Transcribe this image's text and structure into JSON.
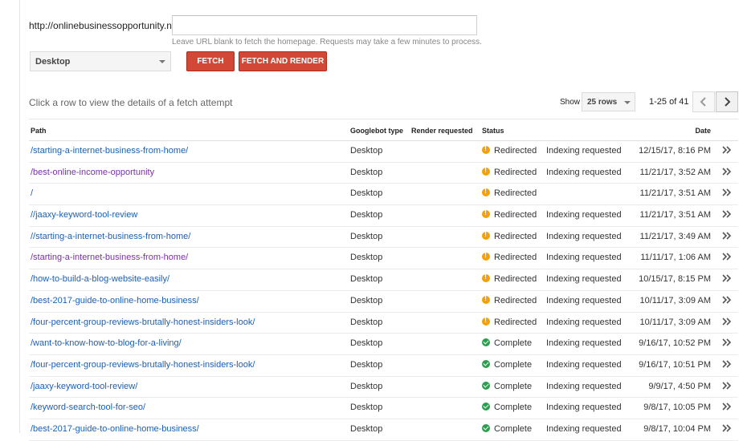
{
  "fetch_form": {
    "url_prefix": "http://onlinebusinessopportunity.net/",
    "url_value": "",
    "url_placeholder": "",
    "url_hint": "Leave URL blank to fetch the homepage. Requests may take a few minutes to process.",
    "device_selected": "Desktop",
    "fetch_label": "FETCH",
    "fetch_render_label": "FETCH AND RENDER",
    "accent_color": "#d14836"
  },
  "toolbar": {
    "hint": "Click a row to view the details of a fetch attempt",
    "show_label": "Show",
    "rows_selected": "25 rows",
    "page_range": "1-25 of 41"
  },
  "table": {
    "headers": {
      "path": "Path",
      "googlebot_type": "Googlebot type",
      "render_requested": "Render requested",
      "status": "Status",
      "date": "Date"
    },
    "rows": [
      {
        "path": "/starting-a-internet-business-from-home/",
        "visited": false,
        "type": "Desktop",
        "status": "Redirected",
        "status_icon": "warning-icon",
        "indexing": "Indexing requested",
        "date": "12/15/17, 8:16 PM"
      },
      {
        "path": "/best-online-income-opportunity",
        "visited": true,
        "type": "Desktop",
        "status": "Redirected",
        "status_icon": "warning-icon",
        "indexing": "Indexing requested",
        "date": "11/21/17, 3:52 AM"
      },
      {
        "path": "/",
        "visited": false,
        "type": "Desktop",
        "status": "Redirected",
        "status_icon": "warning-icon",
        "indexing": "",
        "date": "11/21/17, 3:51 AM"
      },
      {
        "path": "//jaaxy-keyword-tool-review",
        "visited": false,
        "type": "Desktop",
        "status": "Redirected",
        "status_icon": "warning-icon",
        "indexing": "Indexing requested",
        "date": "11/21/17, 3:51 AM"
      },
      {
        "path": "//starting-a-internet-business-from-home/",
        "visited": false,
        "type": "Desktop",
        "status": "Redirected",
        "status_icon": "warning-icon",
        "indexing": "Indexing requested",
        "date": "11/21/17, 3:49 AM"
      },
      {
        "path": "/starting-a-internet-business-from-home/",
        "visited": true,
        "type": "Desktop",
        "status": "Redirected",
        "status_icon": "warning-icon",
        "indexing": "Indexing requested",
        "date": "11/11/17, 1:06 AM"
      },
      {
        "path": "/how-to-build-a-blog-website-easily/",
        "visited": false,
        "type": "Desktop",
        "status": "Redirected",
        "status_icon": "warning-icon",
        "indexing": "Indexing requested",
        "date": "10/15/17, 8:15 PM"
      },
      {
        "path": "/best-2017-guide-to-online-home-business/",
        "visited": false,
        "type": "Desktop",
        "status": "Redirected",
        "status_icon": "warning-icon",
        "indexing": "Indexing requested",
        "date": "10/11/17, 3:09 AM"
      },
      {
        "path": "/four-percent-group-reviews-brutally-honest-insiders-look/",
        "visited": false,
        "type": "Desktop",
        "status": "Redirected",
        "status_icon": "warning-icon",
        "indexing": "Indexing requested",
        "date": "10/11/17, 3:09 AM"
      },
      {
        "path": "/want-to-know-how-to-blog-for-a-living/",
        "visited": false,
        "type": "Desktop",
        "status": "Complete",
        "status_icon": "check-icon",
        "indexing": "Indexing requested",
        "date": "9/16/17, 10:52 PM"
      },
      {
        "path": "/four-percent-group-reviews-brutally-honest-insiders-look/",
        "visited": false,
        "type": "Desktop",
        "status": "Complete",
        "status_icon": "check-icon",
        "indexing": "Indexing requested",
        "date": "9/16/17, 10:51 PM"
      },
      {
        "path": "/jaaxy-keyword-tool-review/",
        "visited": false,
        "type": "Desktop",
        "status": "Complete",
        "status_icon": "check-icon",
        "indexing": "Indexing requested",
        "date": "9/9/17, 4:50 PM"
      },
      {
        "path": "/keyword-search-tool-for-seo/",
        "visited": false,
        "type": "Desktop",
        "status": "Complete",
        "status_icon": "check-icon",
        "indexing": "Indexing requested",
        "date": "9/8/17, 10:05 PM"
      },
      {
        "path": "/best-2017-guide-to-online-home-business/",
        "visited": false,
        "type": "Desktop",
        "status": "Complete",
        "status_icon": "check-icon",
        "indexing": "Indexing requested",
        "date": "9/8/17, 10:04 PM"
      }
    ]
  }
}
